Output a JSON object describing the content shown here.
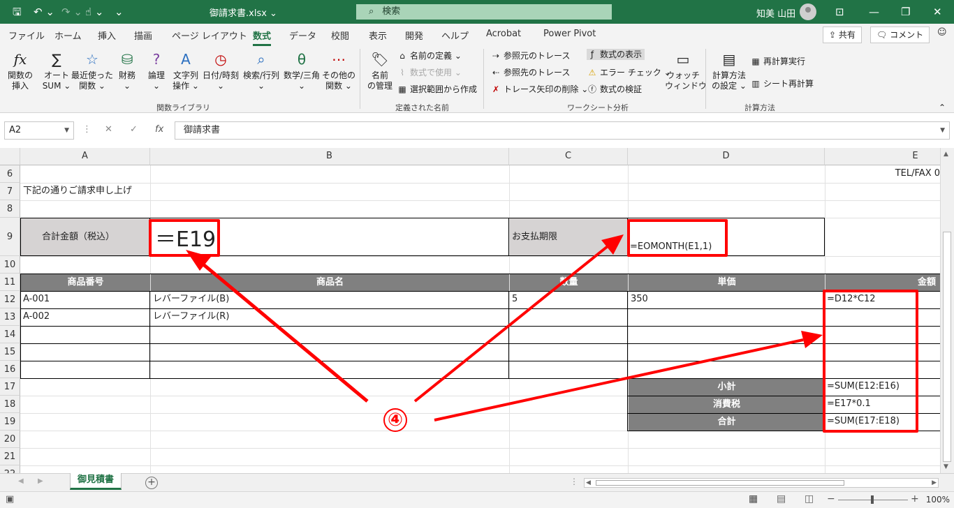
{
  "window": {
    "file_name": "御請求書.xlsx",
    "search_label": "検索",
    "user_name": "知美 山田"
  },
  "ribbon_tabs": [
    "ファイル",
    "ホーム",
    "挿入",
    "描画",
    "ページ レイアウト",
    "数式",
    "データ",
    "校閲",
    "表示",
    "開発",
    "ヘルプ",
    "Acrobat",
    "Power Pivot"
  ],
  "ribbon_right": {
    "share": "共有",
    "comment": "コメント"
  },
  "ribbon": {
    "insert_function": "関数の\n挿入",
    "autosum": "オート\nSUM ⌄",
    "recent": "最近使った\n関数 ⌄",
    "financial": "財務\n⌄",
    "logical": "論理\n⌄",
    "text": "文字列\n操作 ⌄",
    "datetime": "日付/時刻\n⌄",
    "lookup": "検索/行列\n⌄",
    "math": "数学/三角\n⌄",
    "more": "その他の\n関数 ⌄",
    "group_library": "関数ライブラリ",
    "name_manager": "名前\nの管理",
    "define_name": "名前の定義 ⌄",
    "use_in_formula": "数式で使用 ⌄",
    "create_from_selection": "選択範囲から作成",
    "group_names": "定義された名前",
    "trace_precedents": "参照元のトレース",
    "trace_dependents": "参照先のトレース",
    "remove_arrows": "トレース矢印の削除 ⌄",
    "show_formulas": "数式の表示",
    "error_checking": "エラー チェック ⌄",
    "evaluate_formula": "数式の検証",
    "group_audit": "ワークシート分析",
    "watch_window": "ウォッチ\nウィンドウ",
    "calc_options": "計算方法\nの設定 ⌄",
    "calc_now": "再計算実行",
    "calc_sheet": "シート再計算",
    "group_calc": "計算方法"
  },
  "formula_bar": {
    "name_box": "A2",
    "content": "御請求書"
  },
  "columns": [
    "A",
    "B",
    "C",
    "D",
    "E"
  ],
  "rows": [
    "6",
    "7",
    "8",
    "9",
    "10",
    "11",
    "12",
    "13",
    "14",
    "15",
    "16",
    "17",
    "18",
    "19",
    "20",
    "21",
    "22"
  ],
  "cells": {
    "e6": "TEL/FAX 0",
    "a7": "下記の通りご請求申し上げ",
    "a9": "合計金額（税込）",
    "b9": "＝E19",
    "c9": "お支払期限",
    "d9": "=EOMONTH(E1,1)",
    "a11": "商品番号",
    "b11": "商品名",
    "c11": "数量",
    "d11": "単価",
    "e11": "金額",
    "a12": "A-001",
    "b12": "レバーファイル(B)",
    "c12": "5",
    "d12": "350",
    "e12": "=D12*C12",
    "a13": "A-002",
    "b13": "レバーファイル(R)",
    "d17": "小計",
    "e17": "=SUM(E12:E16)",
    "d18": "消費税",
    "e18": "=E17*0.1",
    "d19": "合計",
    "e19": "=SUM(E17:E18)"
  },
  "annotation": {
    "label": "④"
  },
  "sheet_tab": "御見積書",
  "zoom": "100%",
  "colors": {
    "accent": "#217346",
    "highlight": "#ff0000",
    "header_fill": "#808080",
    "label_fill": "#d6d3d3"
  }
}
